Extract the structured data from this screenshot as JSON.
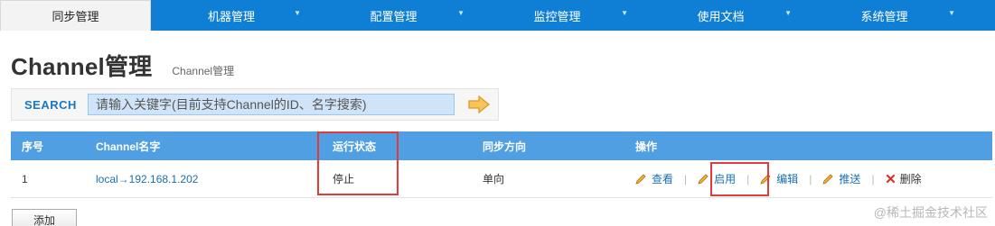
{
  "nav": {
    "tabs": [
      {
        "label": "同步管理",
        "active": true
      },
      {
        "label": "机器管理",
        "active": false
      },
      {
        "label": "配置管理",
        "active": false
      },
      {
        "label": "监控管理",
        "active": false
      },
      {
        "label": "使用文档",
        "active": false
      },
      {
        "label": "系统管理",
        "active": false
      }
    ],
    "dropdown_glyph": "▼"
  },
  "page": {
    "title": "Channel管理",
    "subtitle": "Channel管理"
  },
  "search": {
    "label": "SEARCH",
    "placeholder": "请输入关键字(目前支持Channel的ID、名字搜索)",
    "go_icon": "arrow-right-icon"
  },
  "table": {
    "columns": [
      "序号",
      "Channel名字",
      "运行状态",
      "同步方向",
      "操作"
    ],
    "rows": [
      {
        "index": "1",
        "name": "local→192.168.1.202",
        "status": "停止",
        "direction": "单向",
        "actions": {
          "view": "查看",
          "enable": "启用",
          "edit": "编辑",
          "push": "推送",
          "delete": "删除"
        }
      }
    ]
  },
  "add_button": "添加",
  "watermark": "@稀土掘金技术社区",
  "colors": {
    "nav": "#0f7fd6",
    "table_header": "#4f9fe2",
    "link": "#1a6fb5",
    "annotation": "#e23b3b",
    "delete_icon": "#d9342b"
  }
}
